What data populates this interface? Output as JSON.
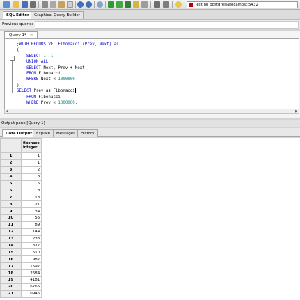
{
  "toolbar": {
    "connection": "Test on postgres@localhost:5432",
    "icons": [
      "new-connection-icon",
      "open-icon",
      "save-icon",
      "save-as-icon",
      "cut-icon",
      "copy-icon",
      "paste-icon",
      "clear-icon",
      "undo-icon",
      "redo-icon",
      "find-icon",
      "execute-icon",
      "execute-pgscript-icon",
      "execute-to-file-icon",
      "explain-icon",
      "cancel-icon",
      "vacuum-icon",
      "help-icon"
    ]
  },
  "tabs": {
    "sql_editor": "SQL Editor",
    "graphical": "Graphical Query Builder"
  },
  "previous_queries": "Previous queries",
  "query_tab": {
    "label": "Query 1*"
  },
  "code": {
    "line1": ";WITH RECURSIVE  Fibonacci (Prev, Next) as",
    "line2": "(",
    "line3_kw": "SELECT",
    "line3_n1": "1",
    "line3_sep": ", ",
    "line3_n2": "1",
    "line4": "UNION ALL",
    "line5_kw": "SELECT",
    "line5_rest": " Next, Prev + Next",
    "line6_kw": "FROM",
    "line6_rest": " Fibonacci",
    "line7_kw": "WHERE",
    "line7_rest": " Next < ",
    "line7_num": "1000000",
    "line8": ")",
    "line9_kw": "SELECT",
    "line9_rest": " Prev as Fibonacci",
    "line10_kw": "FROM",
    "line10_rest": " Fibonacci",
    "line11_kw": "WHERE",
    "line11_rest": " Prev < ",
    "line11_num": "1000000",
    "line11_end": ";"
  },
  "output": {
    "title": "Output pane [Query 1]",
    "tabs": [
      "Data Output",
      "Explain",
      "Messages",
      "History"
    ],
    "column": {
      "name": "fibonacci",
      "type": "integer"
    },
    "rows": [
      {
        "n": "1",
        "v": "1"
      },
      {
        "n": "2",
        "v": "1"
      },
      {
        "n": "3",
        "v": "2"
      },
      {
        "n": "4",
        "v": "3"
      },
      {
        "n": "5",
        "v": "5"
      },
      {
        "n": "6",
        "v": "8"
      },
      {
        "n": "7",
        "v": "13"
      },
      {
        "n": "8",
        "v": "21"
      },
      {
        "n": "9",
        "v": "34"
      },
      {
        "n": "10",
        "v": "55"
      },
      {
        "n": "11",
        "v": "89"
      },
      {
        "n": "12",
        "v": "144"
      },
      {
        "n": "13",
        "v": "233"
      },
      {
        "n": "14",
        "v": "377"
      },
      {
        "n": "15",
        "v": "610"
      },
      {
        "n": "16",
        "v": "987"
      },
      {
        "n": "17",
        "v": "1597"
      },
      {
        "n": "18",
        "v": "2584"
      },
      {
        "n": "19",
        "v": "4181"
      },
      {
        "n": "20",
        "v": "6765"
      },
      {
        "n": "21",
        "v": "10946"
      }
    ]
  }
}
